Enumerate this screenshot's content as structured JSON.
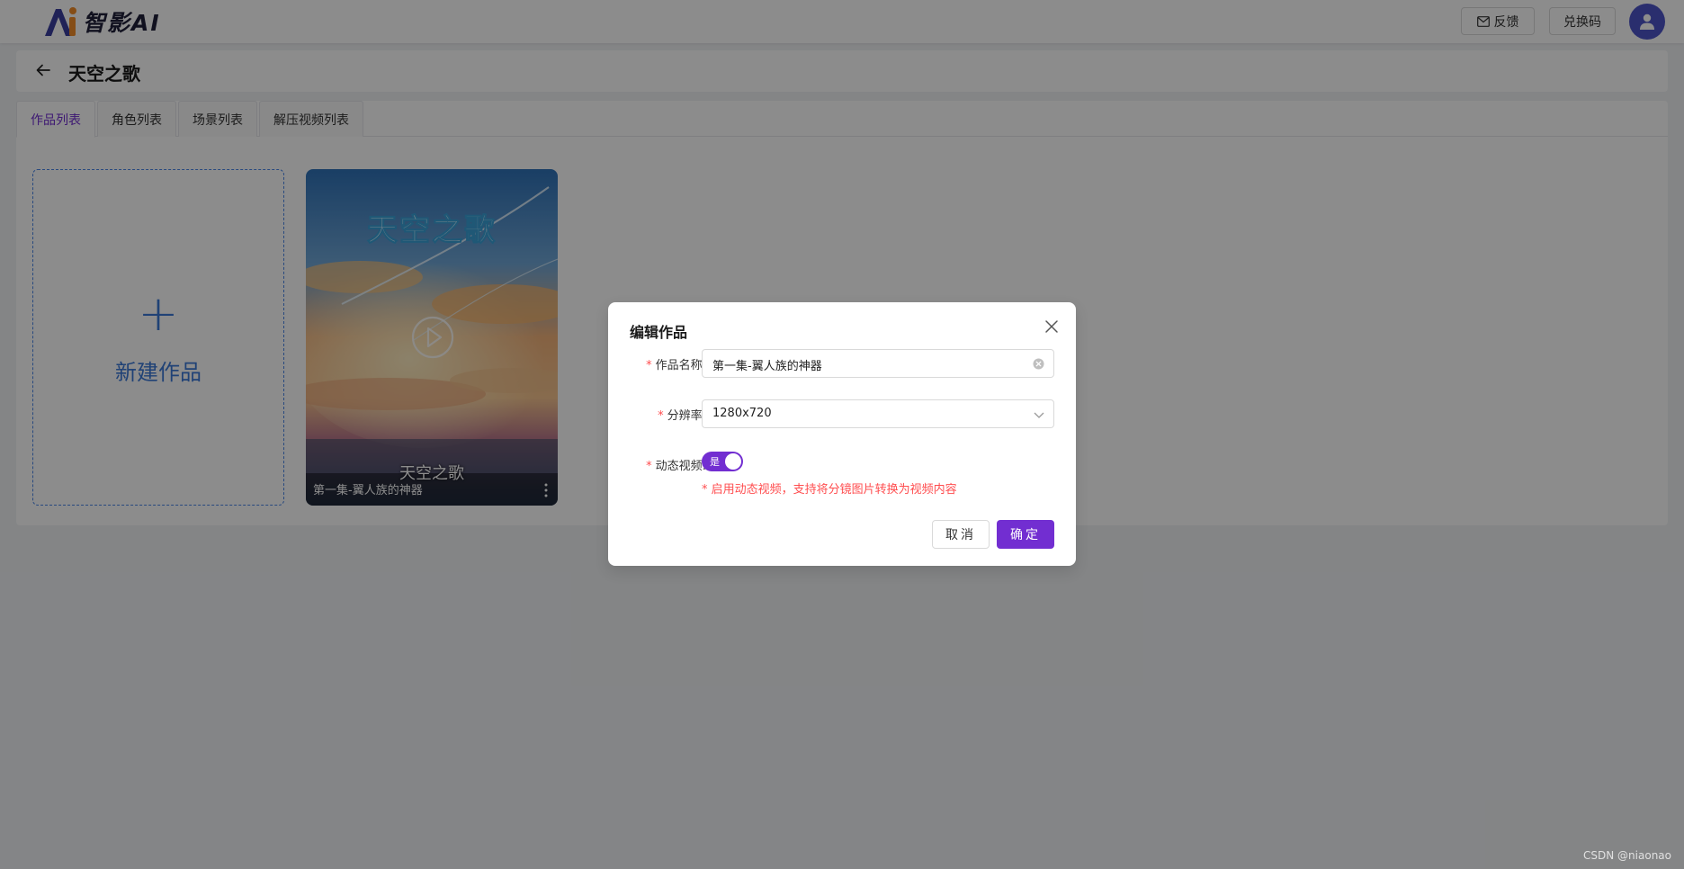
{
  "app": {
    "name": "智影AI"
  },
  "header": {
    "feedback_label": "反馈",
    "redeem_label": "兑换码"
  },
  "page": {
    "title": "天空之歌"
  },
  "tabs": [
    {
      "label": "作品列表",
      "active": true
    },
    {
      "label": "角色列表",
      "active": false
    },
    {
      "label": "场景列表",
      "active": false
    },
    {
      "label": "解压视频列表",
      "active": false
    }
  ],
  "new_card": {
    "plus": "+",
    "label": "新建作品"
  },
  "works": [
    {
      "cover_title": "天空之歌",
      "cover_subtitle": "天空之歌",
      "name": "第一集-翼人族的神器"
    }
  ],
  "modal": {
    "title": "编辑作品",
    "fields": {
      "name": {
        "label": "作品名称:",
        "value": "第一集-翼人族的神器"
      },
      "resolution": {
        "label": "分辨率:",
        "value": "1280x720"
      },
      "dynamic": {
        "label": "动态视频:",
        "toggle_label": "是",
        "on": true,
        "hint": "* 启用动态视频，支持将分镜图片转换为视频内容"
      }
    },
    "required_mark": "*",
    "cancel_label": "取消",
    "ok_label": "确定"
  },
  "watermark": "CSDN @niaonao",
  "colors": {
    "accent": "#722ed1",
    "link": "#3b78d8",
    "danger": "#ff4d4f",
    "avatar": "#4e54c8"
  },
  "icons": [
    "logo-icon",
    "mail-icon",
    "user-icon",
    "back-arrow-icon",
    "play-icon",
    "more-vertical-icon",
    "close-icon",
    "clear-icon",
    "chevron-down-icon"
  ]
}
